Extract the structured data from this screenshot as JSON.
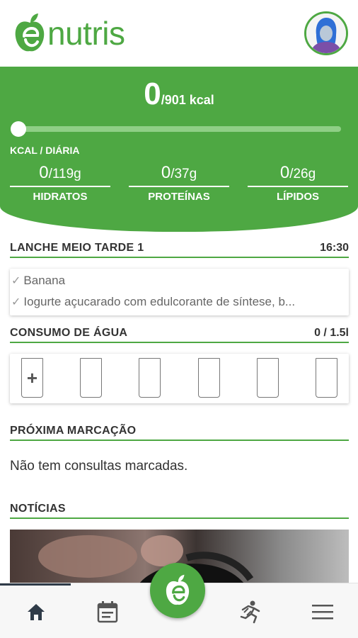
{
  "header": {
    "logo_text": "nutris",
    "brand_color": "#4ea843",
    "avatar_icon": "user-avatar-icon"
  },
  "summary": {
    "kcal_consumed": "0",
    "kcal_target": "/901 kcal",
    "kcal_progress": 0,
    "kcal_caption": "KCAL / DIÁRIA",
    "macros": [
      {
        "consumed": "0",
        "target": "/119g",
        "label": "HIDRATOS"
      },
      {
        "consumed": "0",
        "target": "/37g",
        "label": "PROTEÍNAS"
      },
      {
        "consumed": "0",
        "target": "/26g",
        "label": "LÍPIDOS"
      }
    ]
  },
  "meal": {
    "title": "LANCHE MEIO TARDE 1",
    "time": "16:30",
    "items": [
      {
        "label": "Banana",
        "icon": "check-icon"
      },
      {
        "label": "Iogurte açucarado com edulcorante de síntese, b...",
        "icon": "check-icon"
      }
    ]
  },
  "water": {
    "title": "CONSUMO DE ÁGUA",
    "amount": "0 / 1.5l",
    "add_symbol": "+",
    "glasses_total": 6,
    "glasses_filled": 0
  },
  "appointment": {
    "title": "PRÓXIMA MARCAÇÃO",
    "empty_text": "Não tem consultas marcadas."
  },
  "news": {
    "title": "NOTÍCIAS"
  },
  "nav": {
    "items": [
      {
        "icon": "home-icon",
        "active": true
      },
      {
        "icon": "calendar-icon",
        "active": false
      },
      {
        "icon": "nutris-logo-icon",
        "active": false
      },
      {
        "icon": "exercise-icon",
        "active": false
      },
      {
        "icon": "menu-icon",
        "active": false
      }
    ],
    "active_color": "#2f3b48"
  }
}
